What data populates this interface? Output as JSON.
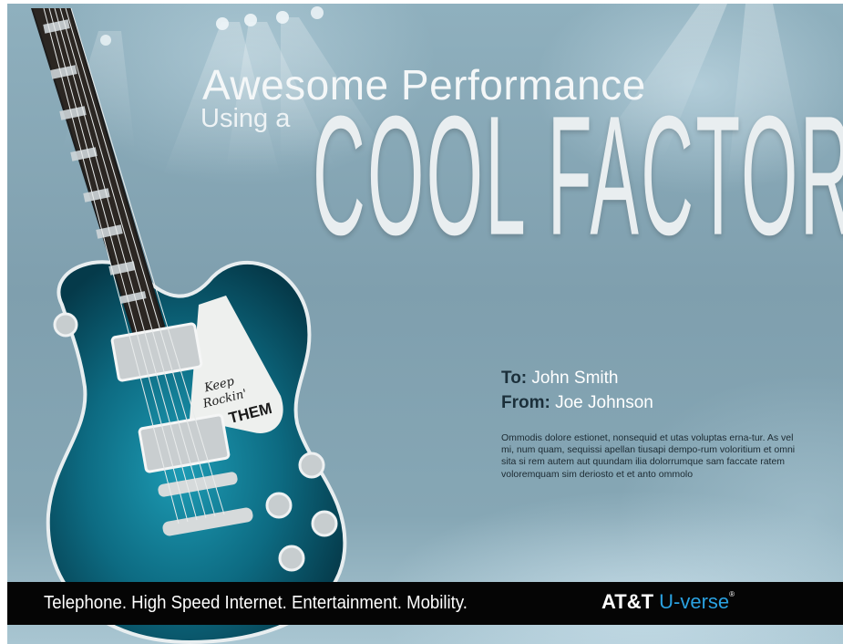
{
  "title": {
    "line1": "Awesome Performance",
    "using": "Using a",
    "big": "COOL FACTOR"
  },
  "guitar": {
    "pickguard_line1": "Keep",
    "pickguard_line2": "Rockin'",
    "pickguard_line3": "THEM"
  },
  "address": {
    "to_label": "To:",
    "to_value": "John Smith",
    "from_label": "From:",
    "from_value": "Joe Johnson"
  },
  "body": "Ommodis dolore estionet, nonsequid et utas voluptas erna-tur. As vel mi, num quam, sequissi apellan tiusapi dempo-rum voloritium et omni sita si rem autem aut quundam ilia dolorrumque sam faccate ratem voloremquam sim deriosto et et anto ommolo",
  "footer": {
    "tagline": "Telephone. High Speed Internet. Entertainment. Mobility.",
    "brand_att": "AT&T",
    "brand_uverse": "U-verse",
    "brand_reg": "®"
  },
  "colors": {
    "background": "#86a7b5",
    "bar": "#050505",
    "uverse_blue": "#2aa1e0",
    "guitar_teal": "#0f6f86"
  }
}
